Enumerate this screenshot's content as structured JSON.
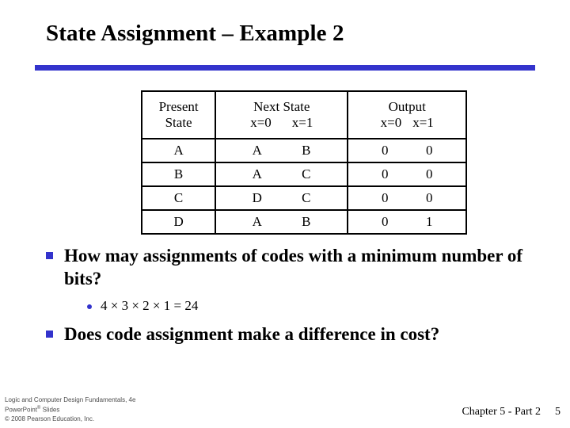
{
  "slide": {
    "title": "State Assignment – Example 2",
    "accent_color": "#3333cc",
    "rule_color": "#3333cc",
    "background_color": "#ffffff",
    "text_color": "#000000"
  },
  "table": {
    "group_headers": [
      {
        "label": "Present",
        "sub": "State"
      },
      {
        "label": "Next State",
        "sub_a": "x=0",
        "sub_b": "x=1"
      },
      {
        "label": "Output",
        "sub_a": "x=0",
        "sub_b": "x=1"
      }
    ],
    "rows": [
      {
        "present": "A",
        "next_x0": "A",
        "next_x1": "B",
        "out_x0": "0",
        "out_x1": "0"
      },
      {
        "present": "B",
        "next_x0": "A",
        "next_x1": "C",
        "out_x0": "0",
        "out_x1": "0"
      },
      {
        "present": "C",
        "next_x0": "D",
        "next_x1": "C",
        "out_x0": "0",
        "out_x1": "0"
      },
      {
        "present": "D",
        "next_x0": "A",
        "next_x1": "B",
        "out_x0": "0",
        "out_x1": "1"
      }
    ]
  },
  "bullets": {
    "item1": "How may assignments of codes with a minimum number of bits?",
    "item1_sub": "4 × 3 × 2 × 1 = 24",
    "item2": "Does code assignment make a difference in cost?"
  },
  "footer": {
    "line1": "Logic and Computer Design Fundamentals, 4e",
    "line2_pre": "PowerPoint",
    "line2_sup": "®",
    "line2_post": " Slides",
    "line3": "© 2008 Pearson Education, Inc.",
    "chapter": "Chapter 5 - Part 2",
    "page": "5"
  }
}
